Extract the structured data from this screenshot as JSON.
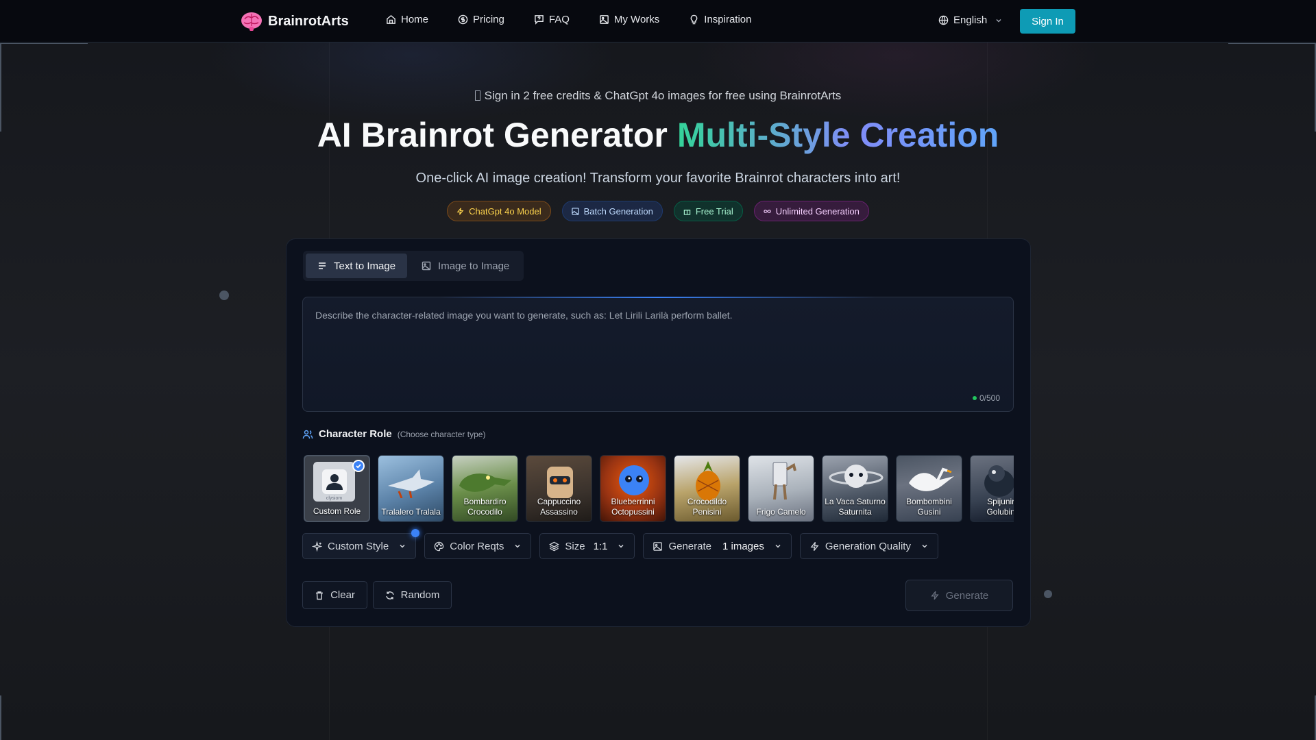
{
  "brand": {
    "name": "BrainrotArts"
  },
  "nav": {
    "items": [
      {
        "label": "Home",
        "icon": "home-icon"
      },
      {
        "label": "Pricing",
        "icon": "dollar-circle-icon"
      },
      {
        "label": "FAQ",
        "icon": "help-message-icon"
      },
      {
        "label": "My Works",
        "icon": "image-icon"
      },
      {
        "label": "Inspiration",
        "icon": "lightbulb-icon"
      }
    ],
    "language": "English",
    "signin": "Sign In"
  },
  "hero": {
    "notice": "Sign in 2 free credits & ChatGpt 4o images for free using BrainrotArts",
    "title_main": "AI Brainrot Generator",
    "title_gradient": "Multi-Style Creation",
    "subtitle": "One-click AI image creation! Transform your favorite Brainrot characters into art!",
    "badges": [
      "ChatGpt 4o Model",
      "Batch Generation",
      "Free Trial",
      "Unlimited Generation"
    ]
  },
  "panel": {
    "tabs": [
      {
        "label": "Text to Image",
        "active": true
      },
      {
        "label": "Image to Image",
        "active": false
      }
    ],
    "prompt": {
      "placeholder": "Describe the character-related image you want to generate, such as: Let Lirili Larilà perform ballet.",
      "value": "",
      "counter": "0/500"
    },
    "role_section": {
      "title": "Character Role",
      "hint": "(Choose character type)"
    },
    "roles": [
      {
        "label": "Custom Role",
        "selected": true,
        "thumb_text": "clysiom"
      },
      {
        "label": "Tralalero Tralala",
        "selected": false,
        "colors": [
          "#7fa2c4",
          "#3d5a80"
        ]
      },
      {
        "label": "Bombardiro Crocodilo",
        "selected": false,
        "colors": [
          "#6b8f4a",
          "#2f4a2a"
        ]
      },
      {
        "label": "Cappuccino Assassino",
        "selected": false,
        "colors": [
          "#8a6a4a",
          "#2e2a2a"
        ]
      },
      {
        "label": "Blueberrinni Octopussini",
        "selected": false,
        "colors": [
          "#c2410c",
          "#1e3a8a"
        ]
      },
      {
        "label": "Crocodildo Penisini",
        "selected": false,
        "colors": [
          "#d4a24a",
          "#5a7a3a"
        ]
      },
      {
        "label": "Frigo Camelo",
        "selected": false,
        "colors": [
          "#a8b0b8",
          "#6b5a48"
        ]
      },
      {
        "label": "La Vaca Saturno Saturnita",
        "selected": false,
        "colors": [
          "#6b7280",
          "#1f2937"
        ]
      },
      {
        "label": "Bombombini Gusini",
        "selected": false,
        "colors": [
          "#9ca3af",
          "#374151"
        ]
      },
      {
        "label": "Spijuniro Golubino",
        "selected": false,
        "colors": [
          "#4b5563",
          "#111827"
        ]
      }
    ],
    "options": [
      {
        "label": "Custom Style",
        "value": "",
        "icon": "sparkles-icon"
      },
      {
        "label": "Color Reqts",
        "value": "",
        "icon": "palette-icon"
      },
      {
        "label": "Size",
        "value": "1:1",
        "icon": "layers-icon"
      },
      {
        "label": "Generate",
        "value": "1 images",
        "icon": "image-icon"
      },
      {
        "label": "Generation Quality",
        "value": "",
        "icon": "zap-icon"
      }
    ],
    "actions": {
      "clear": "Clear",
      "random": "Random",
      "generate": "Generate"
    }
  },
  "colors": {
    "accent": "#0e9bb5",
    "selected": "#3b82f6"
  }
}
